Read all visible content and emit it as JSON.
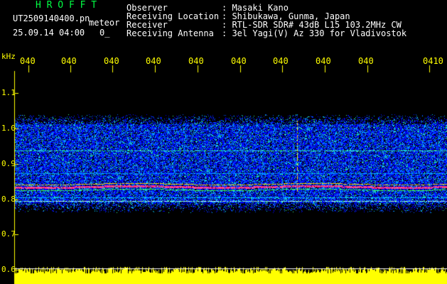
{
  "header": {
    "title": "H R O F F T",
    "filename": "UT2509140400.pn",
    "meteor_label": "meteor",
    "datetime": "25.09.14 04:00",
    "counter": "0_"
  },
  "info": {
    "labels": [
      "Observer",
      "Receiving Location",
      "Receiver",
      "Receiving Antenna"
    ],
    "values": [
      ": Masaki Kano",
      ": Shibukawa, Gunma, Japan",
      ": RTL-SDR SDR# 43dB L15 103.2MHz CW",
      ": 3el Yagi(V) Az 330 for Vladivostok"
    ]
  },
  "time_axis": {
    "labels": [
      "040",
      "040",
      "040",
      "040",
      "040",
      "040",
      "040",
      "040",
      "040",
      "0410"
    ]
  },
  "freq_axis": {
    "unit": "kHz",
    "labels": [
      "1.1",
      "1.0",
      "0.9",
      "0.8",
      "0.7",
      "0.6"
    ]
  },
  "colors": {
    "title": "#00ff44",
    "text": "#ffffff",
    "axis": "#ffff00",
    "band": "#ff2060",
    "noise": "#0033ff"
  }
}
